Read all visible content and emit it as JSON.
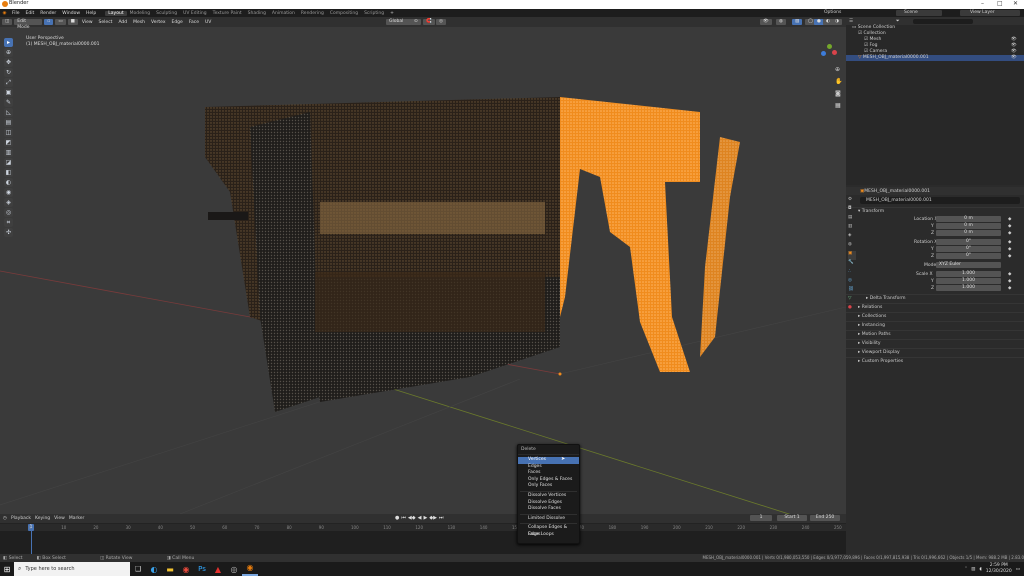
{
  "window": {
    "title": "Blender"
  },
  "topmenu": [
    "File",
    "Edit",
    "Render",
    "Window",
    "Help"
  ],
  "workspaces": [
    {
      "label": "Layout",
      "active": true
    },
    {
      "label": "Modeling"
    },
    {
      "label": "Sculpting"
    },
    {
      "label": "UV Editing"
    },
    {
      "label": "Texture Paint"
    },
    {
      "label": "Shading"
    },
    {
      "label": "Animation"
    },
    {
      "label": "Rendering"
    },
    {
      "label": "Compositing"
    },
    {
      "label": "Scripting"
    }
  ],
  "scene": {
    "name": "Scene",
    "view_layer": "View Layer"
  },
  "viewport": {
    "mode": "Edit Mode",
    "menus": [
      "View",
      "Select",
      "Add",
      "Mesh",
      "Vertex",
      "Edge",
      "Face",
      "UV"
    ],
    "orientation": "Global",
    "options_label": "Options",
    "overlay_title": "User Perspective",
    "overlay_object": "(1) MESH_OBJ_material0000.001"
  },
  "outliner": {
    "items": [
      {
        "label": "Scene Collection",
        "indent": 0
      },
      {
        "label": "Collection",
        "indent": 1
      },
      {
        "label": "Mesh",
        "indent": 2
      },
      {
        "label": "Fog",
        "indent": 2
      },
      {
        "label": "Camera",
        "indent": 2
      },
      {
        "label": "MESH_OBJ_material0000.001",
        "indent": 1,
        "selected": true
      }
    ]
  },
  "properties": {
    "header_object": "MESH_OBJ_material0000.001",
    "object_name": "MESH_OBJ_material0000.001",
    "transform_label": "Transform",
    "location": {
      "label": "Location X",
      "x": "0 m",
      "y": "0 m",
      "z": "0 m"
    },
    "rotation": {
      "label": "Rotation X",
      "x": "0°",
      "y": "0°",
      "z": "0°"
    },
    "mode": {
      "label": "Mode",
      "value": "XYZ Euler"
    },
    "scale": {
      "label": "Scale X",
      "x": "1.000",
      "y": "1.000",
      "z": "1.000"
    },
    "axis_y": "Y",
    "axis_z": "Z",
    "delta": "Delta Transform",
    "sections": [
      "Relations",
      "Collections",
      "Instancing",
      "Motion Paths",
      "Visibility",
      "Viewport Display",
      "Custom Properties"
    ]
  },
  "timeline": {
    "menus": [
      "Playback",
      "Keying",
      "View",
      "Marker"
    ],
    "current_frame": "1",
    "start_label": "Start",
    "start": "1",
    "end_label": "End",
    "end": "250",
    "ticks": [
      "0",
      "10",
      "20",
      "30",
      "40",
      "50",
      "60",
      "70",
      "80",
      "90",
      "100",
      "110",
      "120",
      "130",
      "140",
      "150",
      "160",
      "170",
      "180",
      "190",
      "200",
      "210",
      "220",
      "230",
      "240",
      "250"
    ]
  },
  "popup": {
    "title": "Delete",
    "items": [
      {
        "label": "Vertices",
        "highlighted": true
      },
      {
        "label": "Edges"
      },
      {
        "label": "Faces"
      },
      {
        "label": "Only Edges & Faces"
      },
      {
        "label": "Only Faces"
      },
      {
        "sep": true
      },
      {
        "label": "Dissolve Vertices"
      },
      {
        "label": "Dissolve Edges"
      },
      {
        "label": "Dissolve Faces"
      },
      {
        "sep": true
      },
      {
        "label": "Limited Dissolve"
      },
      {
        "sep": true
      },
      {
        "label": "Collapse Edges & Faces"
      },
      {
        "label": "Edge Loops"
      }
    ]
  },
  "statusbar": {
    "left": [
      "Select",
      "Box Select",
      "Rotate View",
      "Call Menu"
    ],
    "right": "MESH_OBJ_material0000.001 | Verts 0/1,980,053,550 | Edges 0/3,977,059,896 | Faces 0/1,997,815,938 | Tris 0/1,996,662 | Objects 1/5 | Mem: 988.2 MB | 2.83.0"
  },
  "taskbar": {
    "search_placeholder": "Type here to search",
    "time": "2:59 PM",
    "date": "12/30/2020"
  },
  "colors": {
    "accent": "#4772b3",
    "selected_points": "#f08c1e",
    "grid_x": "#7a3b3b",
    "grid_y": "#6b7a2c"
  }
}
